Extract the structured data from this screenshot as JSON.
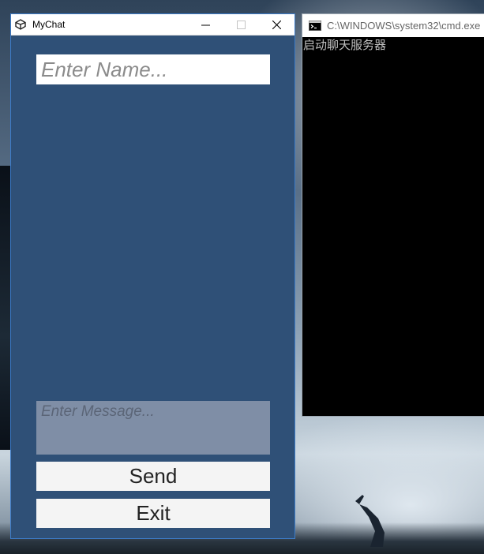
{
  "desktop": {
    "wallpaper": "moonlit-figure-wallpaper"
  },
  "mychat": {
    "title": "MyChat",
    "icon": "unity-logo-icon",
    "controls": {
      "minimize": "—",
      "maximize": "☐",
      "close": "✕"
    },
    "name_input": {
      "placeholder": "Enter Name...",
      "value": ""
    },
    "message_input": {
      "placeholder": "Enter Message...",
      "value": ""
    },
    "send_label": "Send",
    "exit_label": "Exit",
    "colors": {
      "panel": "#2f5077",
      "message_bg": "#7f8ea6",
      "button_bg": "#f4f4f4"
    }
  },
  "cmd": {
    "title": "C:\\WINDOWS\\system32\\cmd.exe",
    "icon": "console-icon",
    "output": "启动聊天服务器"
  }
}
